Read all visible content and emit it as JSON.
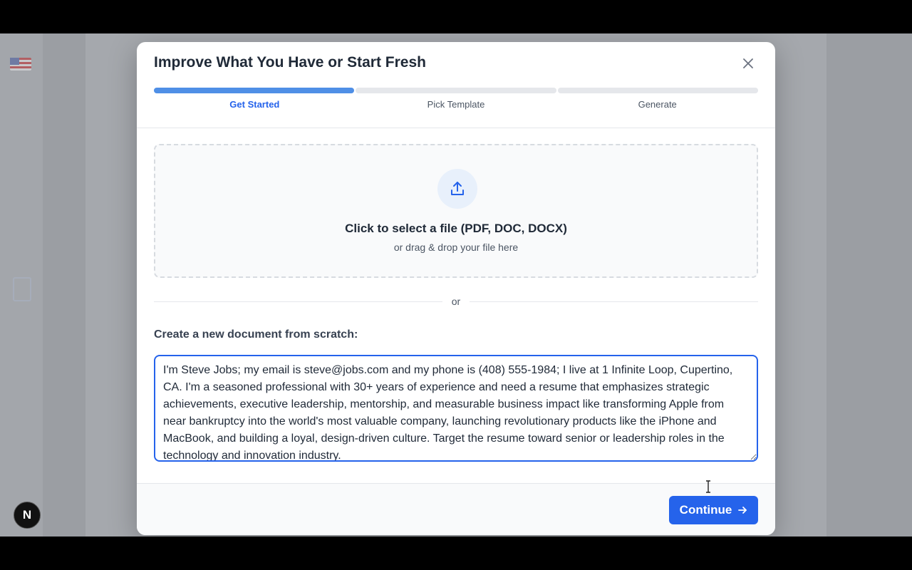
{
  "modal": {
    "title": "Improve What You Have or Start Fresh",
    "close_icon": "close-icon"
  },
  "progress": {
    "steps": [
      {
        "label": "Get Started",
        "active": true
      },
      {
        "label": "Pick Template",
        "active": false
      },
      {
        "label": "Generate",
        "active": false
      }
    ]
  },
  "upload": {
    "icon": "upload-icon",
    "title": "Click to select a file (PDF, DOC, DOCX)",
    "subtitle": "or drag & drop your file here"
  },
  "divider_text": "or",
  "scratch": {
    "label": "Create a new document from scratch:",
    "value": "I'm Steve Jobs; my email is steve@jobs.com and my phone is (408) 555-1984; I live at 1 Infinite Loop, Cupertino, CA. I'm a seasoned professional with 30+ years of experience and need a resume that emphasizes strategic achievements, executive leadership, mentorship, and measurable business impact like transforming Apple from near bankruptcy into the world's most valuable company, launching revolutionary products like the iPhone and MacBook, and building a loyal, design-driven culture. Target the resume toward senior or leadership roles in the technology and innovation industry."
  },
  "footer": {
    "continue_label": "Continue",
    "continue_icon": "arrow-right-icon"
  },
  "background": {
    "badge_letter": "N"
  },
  "colors": {
    "accent": "#2563eb",
    "progress_active": "#4f8fe6",
    "progress_inactive": "#e5e7eb"
  }
}
